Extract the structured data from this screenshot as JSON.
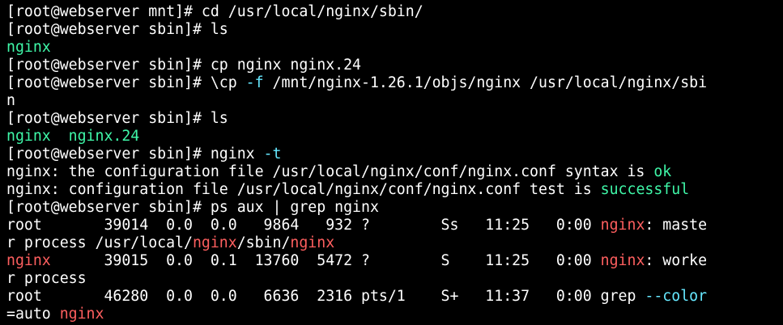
{
  "colors": {
    "background": "#000000",
    "text": "#ffffff",
    "green": "#3ff7a8",
    "red": "#ff5f5f",
    "cyan": "#66e8ff"
  },
  "terminal": {
    "lines": [
      {
        "id": "l1",
        "segments": [
          {
            "t": "[root@webserver mnt]# cd /usr/local/nginx/sbin/",
            "c": "w"
          }
        ]
      },
      {
        "id": "l2",
        "segments": [
          {
            "t": "[root@webserver sbin]# ls",
            "c": "w"
          }
        ]
      },
      {
        "id": "l3",
        "segments": [
          {
            "t": "nginx",
            "c": "g"
          }
        ]
      },
      {
        "id": "l4",
        "segments": [
          {
            "t": "[root@webserver sbin]# cp nginx nginx.24",
            "c": "w"
          }
        ]
      },
      {
        "id": "l5",
        "segments": [
          {
            "t": "[root@webserver sbin]# \\cp ",
            "c": "w"
          },
          {
            "t": "-f",
            "c": "c"
          },
          {
            "t": " /mnt/nginx-1.26.1/objs/nginx /usr/local/nginx/sbi",
            "c": "w"
          }
        ]
      },
      {
        "id": "l6",
        "segments": [
          {
            "t": "n",
            "c": "w"
          }
        ]
      },
      {
        "id": "l7",
        "segments": [
          {
            "t": "[root@webserver sbin]# ls",
            "c": "w"
          }
        ]
      },
      {
        "id": "l8",
        "segments": [
          {
            "t": "nginx  nginx.24",
            "c": "g"
          }
        ]
      },
      {
        "id": "l9",
        "segments": [
          {
            "t": "[root@webserver sbin]# nginx ",
            "c": "w"
          },
          {
            "t": "-t",
            "c": "c"
          }
        ]
      },
      {
        "id": "l10",
        "segments": [
          {
            "t": "nginx: the configuration file /usr/local/nginx/conf/nginx.conf syntax is ",
            "c": "w"
          },
          {
            "t": "ok",
            "c": "g"
          }
        ]
      },
      {
        "id": "l11",
        "segments": [
          {
            "t": "nginx: configuration file /usr/local/nginx/conf/nginx.conf test is ",
            "c": "w"
          },
          {
            "t": "successful",
            "c": "g"
          }
        ]
      },
      {
        "id": "l12",
        "segments": [
          {
            "t": "[root@webserver sbin]# ps aux | grep nginx",
            "c": "w"
          }
        ]
      },
      {
        "id": "l13",
        "segments": [
          {
            "t": "root       39014  0.0  0.0   9864   932 ?        Ss   11:25   0:00 ",
            "c": "w"
          },
          {
            "t": "nginx",
            "c": "r"
          },
          {
            "t": ": maste",
            "c": "w"
          }
        ]
      },
      {
        "id": "l14",
        "segments": [
          {
            "t": "r process /usr/local/",
            "c": "w"
          },
          {
            "t": "nginx",
            "c": "r"
          },
          {
            "t": "/sbin/",
            "c": "w"
          },
          {
            "t": "nginx",
            "c": "r"
          }
        ]
      },
      {
        "id": "l15",
        "segments": [
          {
            "t": "nginx",
            "c": "r"
          },
          {
            "t": "      39015  0.0  0.1  13760  5472 ?        S    11:25   0:00 ",
            "c": "w"
          },
          {
            "t": "nginx",
            "c": "r"
          },
          {
            "t": ": worke",
            "c": "w"
          }
        ]
      },
      {
        "id": "l16",
        "segments": [
          {
            "t": "r process",
            "c": "w"
          }
        ]
      },
      {
        "id": "l17",
        "segments": [
          {
            "t": "root       46280  0.0  0.0   6636  2316 pts/1    S+   11:37   0:00 grep ",
            "c": "w"
          },
          {
            "t": "--color",
            "c": "c"
          }
        ]
      },
      {
        "id": "l18",
        "segments": [
          {
            "t": "=auto ",
            "c": "w"
          },
          {
            "t": "nginx",
            "c": "r"
          }
        ]
      }
    ]
  }
}
